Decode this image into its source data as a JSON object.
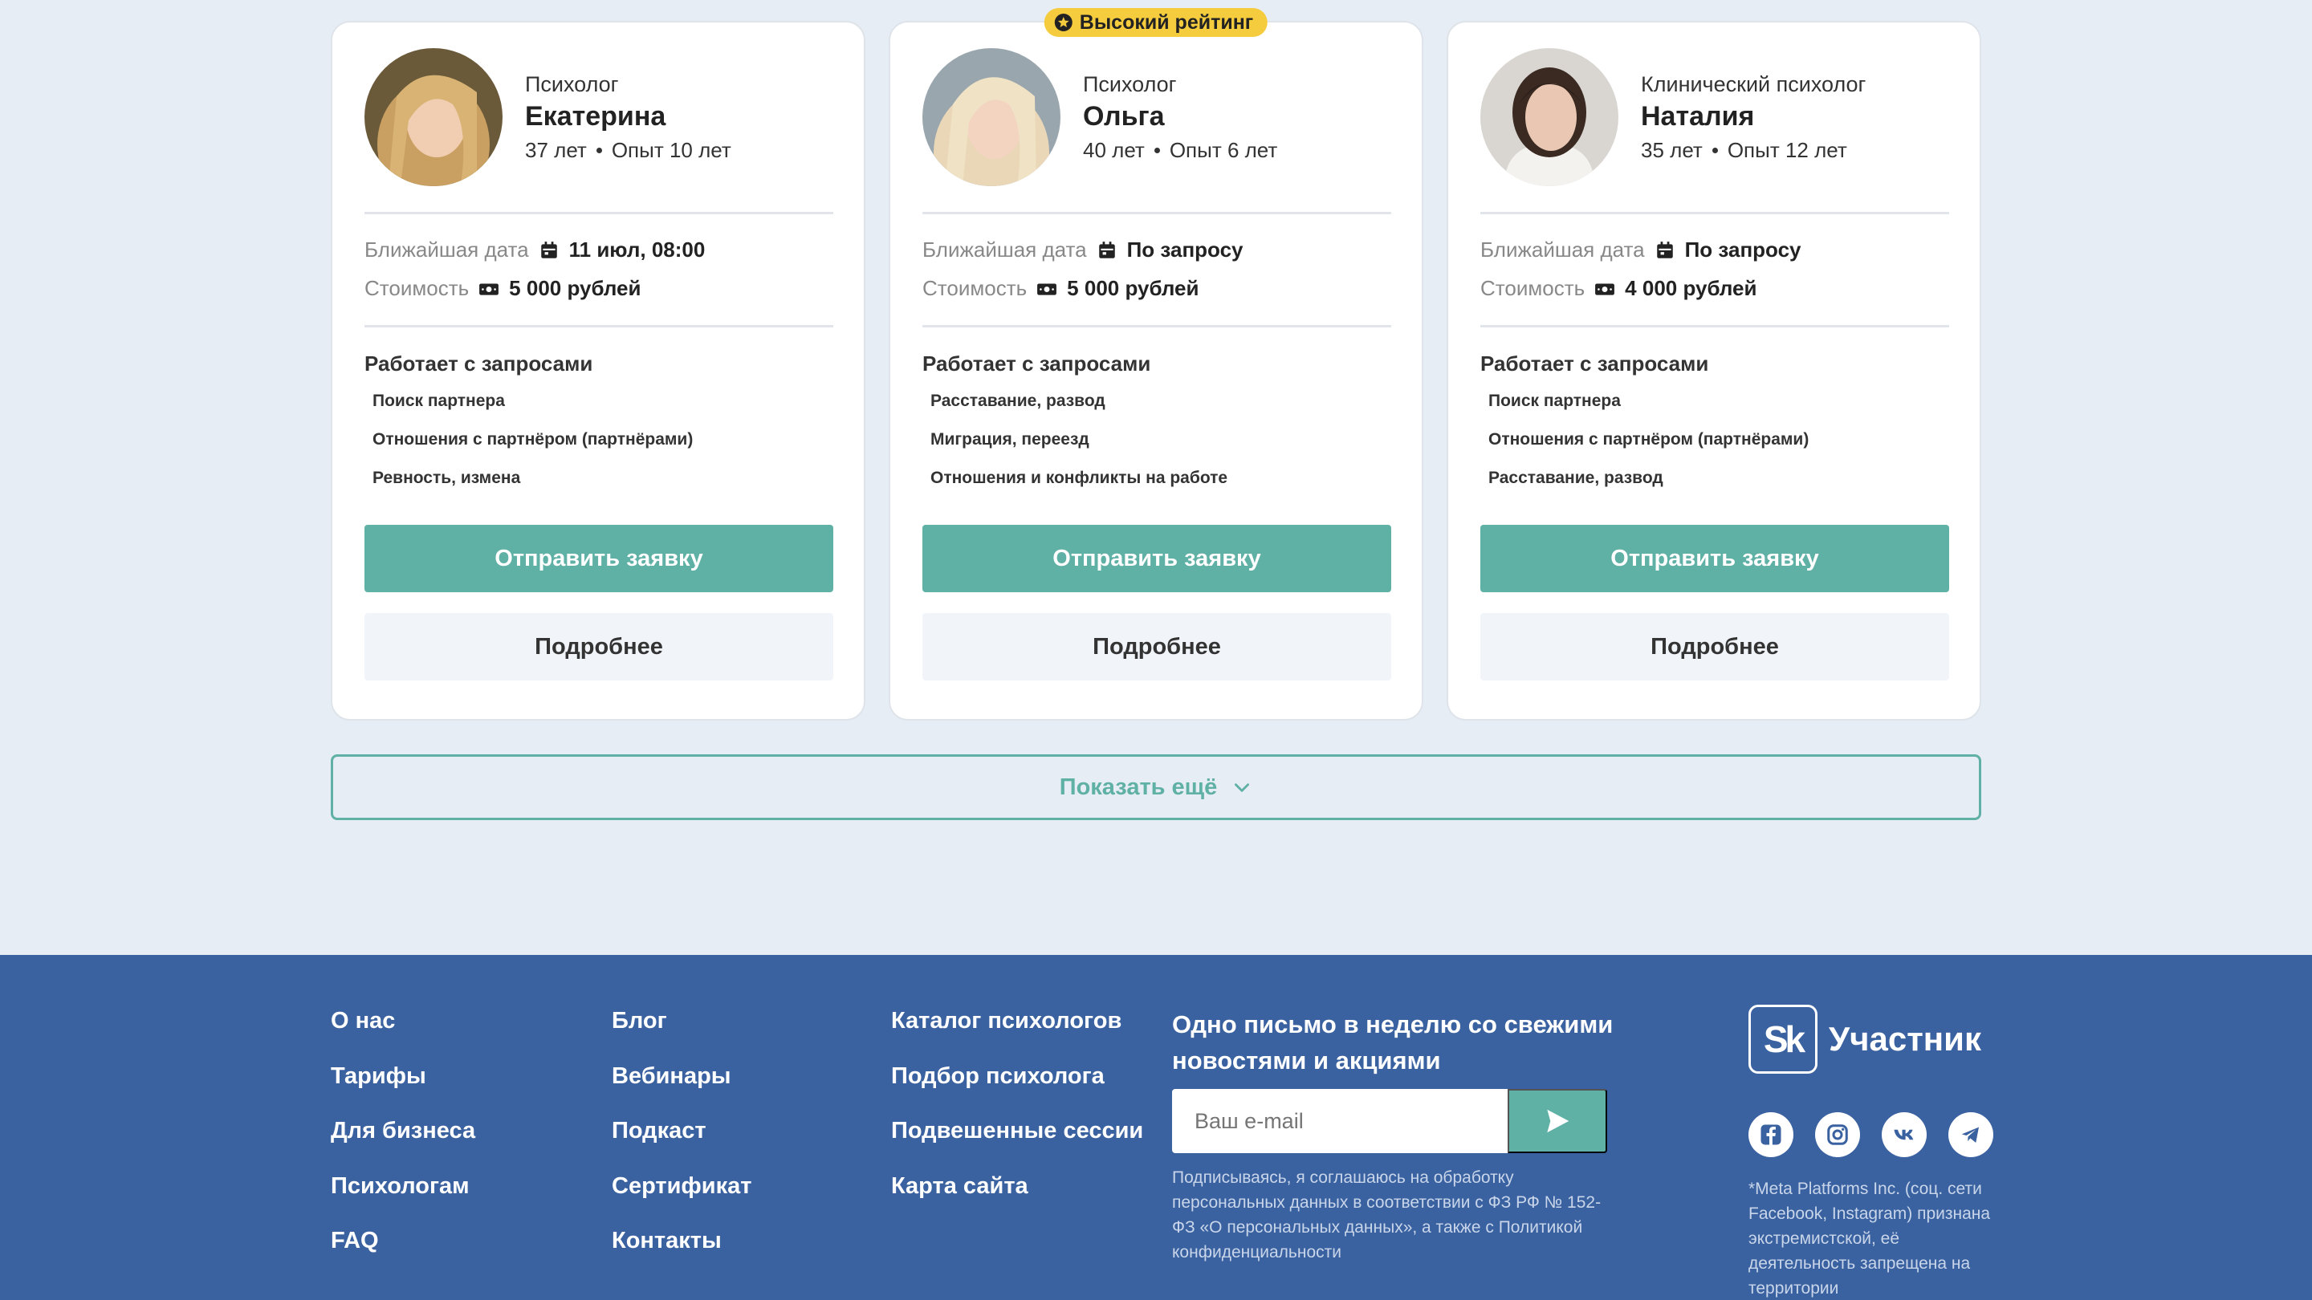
{
  "colors": {
    "accent": "#5fb0a5",
    "footer_bg": "#3a61a0",
    "badge": "#f5cc3e",
    "page_bg": "#e7edf4"
  },
  "labels": {
    "nearest_date": "Ближайшая дата",
    "cost": "Стоимость",
    "works_with": "Работает с запросами",
    "submit": "Отправить заявку",
    "details": "Подробнее"
  },
  "cards": [
    {
      "role": "Психолог",
      "name": "Екатерина",
      "age": "37 лет",
      "experience": "Опыт 10 лет",
      "date": "11 июл, 08:00",
      "price": "5 000 рублей",
      "topics": [
        "Поиск партнера",
        "Отношения с партнёром (партнёрами)",
        "Ревность, измена"
      ]
    },
    {
      "badge": "Высокий рейтинг",
      "role": "Психолог",
      "name": "Ольга",
      "age": "40 лет",
      "experience": "Опыт 6 лет",
      "date": "По запросу",
      "price": "5 000 рублей",
      "topics": [
        "Расставание, развод",
        "Миграция, переезд",
        "Отношения и конфликты на работе"
      ]
    },
    {
      "role": "Клинический психолог",
      "name": "Наталия",
      "age": "35 лет",
      "experience": "Опыт 12 лет",
      "date": "По запросу",
      "price": "4 000 рублей",
      "topics": [
        "Поиск партнера",
        "Отношения с партнёром (партнёрами)",
        "Расставание, развод"
      ]
    }
  ],
  "show_more": "Показать ещё",
  "footer": {
    "col1": [
      "О нас",
      "Тарифы",
      "Для бизнеса",
      "Психологам",
      "FAQ"
    ],
    "col2": [
      "Блог",
      "Вебинары",
      "Подкаст",
      "Сертификат",
      "Контакты"
    ],
    "col3": [
      "Каталог психологов",
      "Подбор психолога",
      "Подвешенные сессии",
      "Карта сайта"
    ],
    "newsletter_title": "Одно письмо в неделю со свежими новостями и акциями",
    "email_placeholder": "Ваш e-mail",
    "consent": "Подписываясь, я соглашаюсь на обработку персональных данных в соответствии с ФЗ РФ № 152-ФЗ «О персональных данных», а также с Политикой конфиденциальности",
    "logo_mark": "Sk",
    "logo_text": "Участник",
    "socials": [
      "facebook-icon",
      "instagram-icon",
      "vk-icon",
      "telegram-icon"
    ],
    "meta_note": "*Meta Platforms Inc. (соц. сети Facebook, Instagram) признана экстремистской, её деятельность запрещена на территории"
  }
}
